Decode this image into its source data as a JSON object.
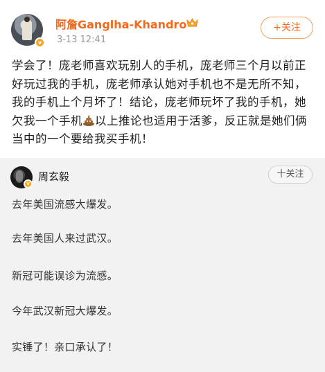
{
  "post1": {
    "author": "阿詹Ganglha-Khandro",
    "time": "3-13 12:41",
    "follow_label": "+关注",
    "body_part1": "学会了！庞老师喜欢玩别人的手机，庞老师三个月以前正好玩过我的手机，庞老师承认她对手机也不是无所不知，我的手机上个月坏了！结论，庞老师玩坏了我的手机，她欠我一个手机",
    "body_part2": "以上推论也适用于活爹，反正就是她们俩当中的一个要给我买手机！",
    "emoji": "poop-emoji",
    "accent_color": "#f26a1b"
  },
  "post2": {
    "author": "周玄毅",
    "follow_label": "十关注",
    "lines": [
      "去年美国流感大爆发。",
      "去年美国人来过武汉。",
      "新冠可能误诊为流感。",
      "今年武汉新冠大爆发。",
      "实锤了！亲口承认了！"
    ],
    "background": "#f2f2f2"
  }
}
